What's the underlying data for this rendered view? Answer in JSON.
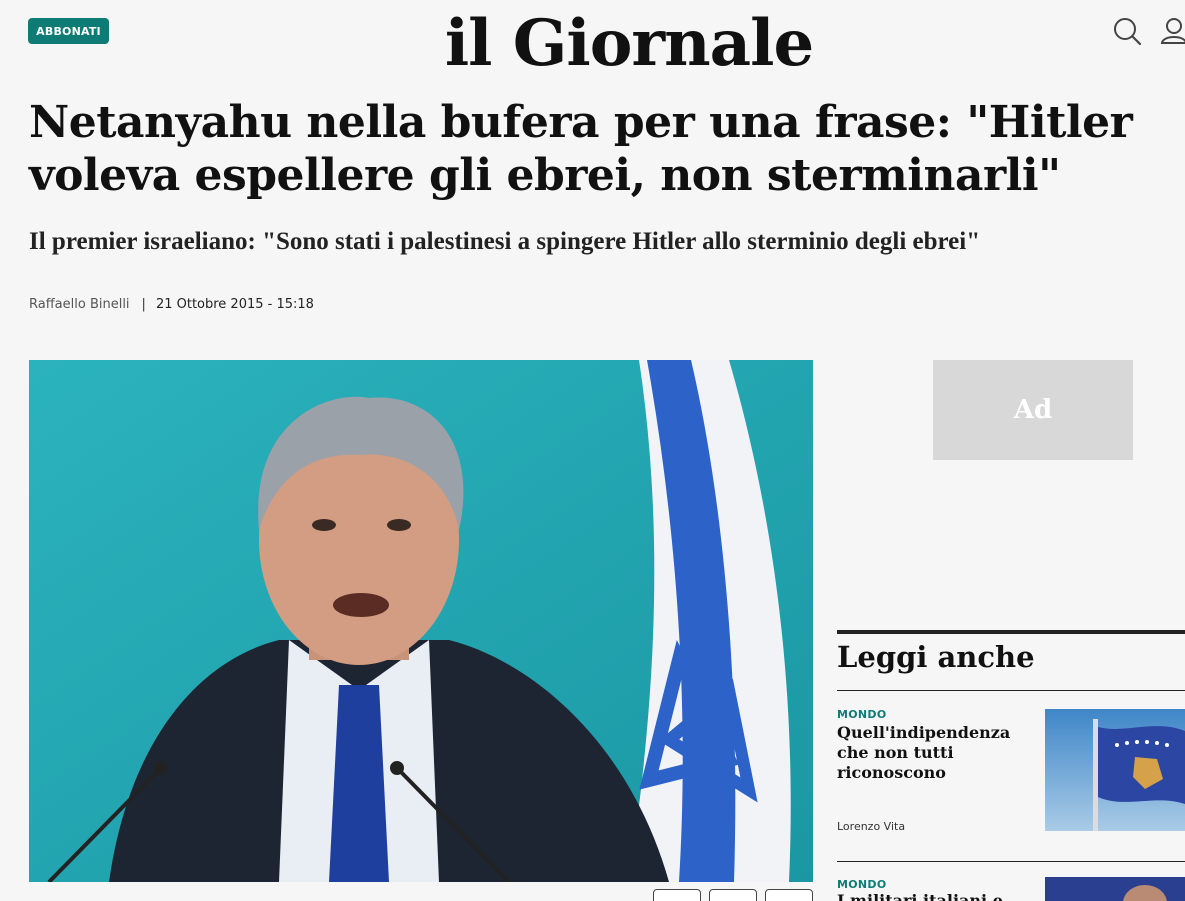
{
  "header": {
    "subscribe_label": "ABBONATI",
    "logo_text": "il Giornale",
    "icons": [
      "search-icon",
      "user-icon"
    ]
  },
  "article": {
    "headline": "Netanyahu nella bufera per una frase: \"Hitler voleva espellere gli ebrei, non sterminarli\"",
    "subheadline": "Il premier israeliano: \"Sono stati i palestinesi a spingere Hitler allo sterminio degli ebrei\"",
    "author": "Raffaello Binelli",
    "separator": "|",
    "date": "21 Ottobre 2015 - 15:18"
  },
  "ad": {
    "label": "Ad"
  },
  "related": {
    "title": "Leggi anche",
    "items": [
      {
        "category": "MONDO",
        "title": "Quell'indipendenza che non tutti riconoscono",
        "author": "Lorenzo Vita"
      },
      {
        "category": "MONDO",
        "title": "I militari italiani e"
      }
    ]
  },
  "colors": {
    "accent": "#0e7c75",
    "background": "#f6f6f6",
    "text": "#111111"
  }
}
